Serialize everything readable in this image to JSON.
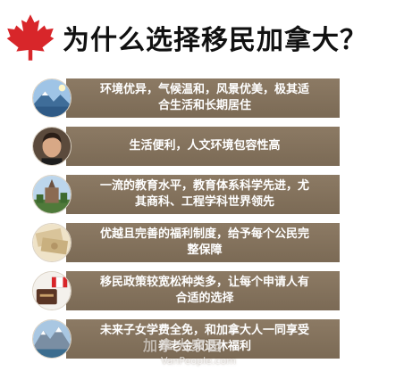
{
  "header": {
    "title": "为什么选择移民加拿大？",
    "logo_icon": "maple-leaf-icon",
    "logo_color": "#d8262a"
  },
  "reasons": [
    {
      "icon": "mountain-lake-photo",
      "lines": [
        "环境优异，气候温和，风景优美，极其适",
        "合生活和长期居住"
      ]
    },
    {
      "icon": "portrait-photo",
      "lines": [
        "生活便利，人文环境包容性高"
      ]
    },
    {
      "icon": "campus-building-photo",
      "lines": [
        "一流的教育水平，教育体系科学先进，尤",
        "其商科、工程学科世界领先"
      ]
    },
    {
      "icon": "money-bills-photo",
      "lines": [
        "优越且完善的福利制度，给予每个公民完",
        "整保障"
      ]
    },
    {
      "icon": "passport-flag-photo",
      "lines": [
        "移民政策较宽松种类多，让每个申请人有",
        "合适的选择"
      ]
    },
    {
      "icon": "snowy-mountain-photo",
      "lines": [
        "未来子女学费全免，和加拿大人一同享受",
        "养老金和退休福利"
      ]
    }
  ],
  "watermark": {
    "cn": "加拿大家园",
    "en": "VanPeople.com"
  },
  "colors": {
    "banner": "#857360",
    "banner_text": "#ffffff"
  }
}
